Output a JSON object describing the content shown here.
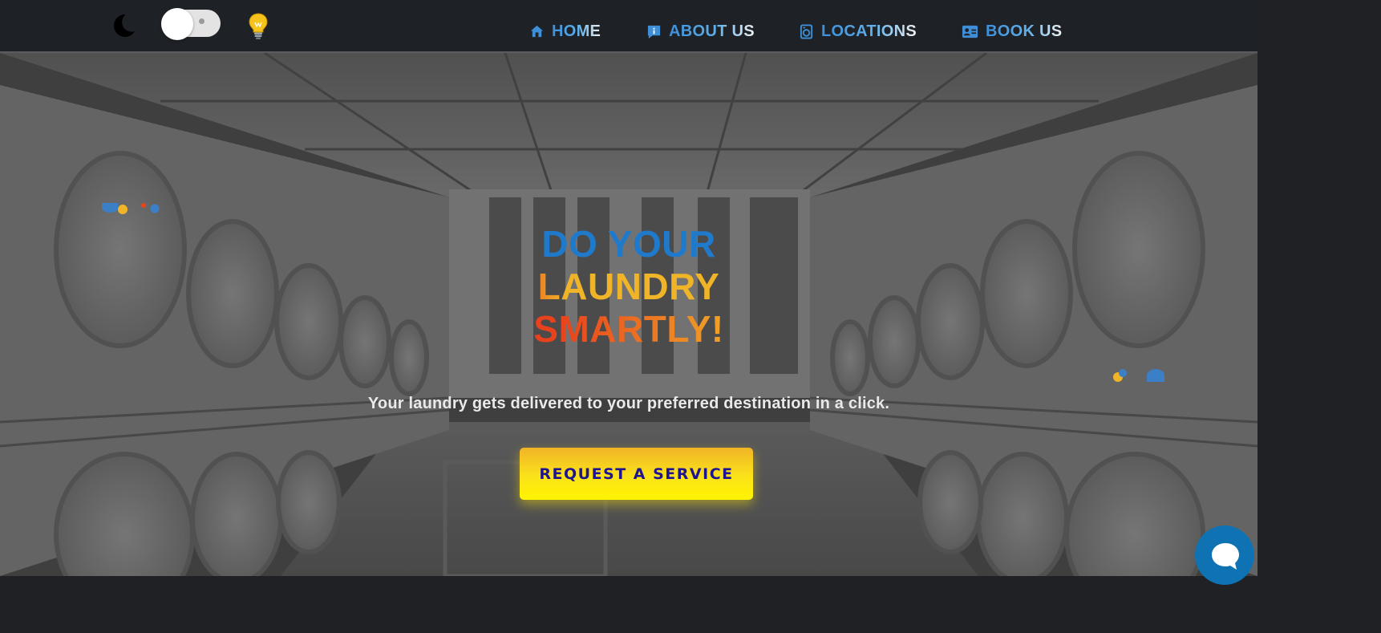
{
  "theme": {
    "dark_mode_enabled": false,
    "accent": "#1f7acc",
    "cta_text_color": "#1f148f",
    "cta_color": "#fbe21a"
  },
  "navbar": {
    "theme_icons": {
      "dark": "moon-icon",
      "light": "lightbulb-icon"
    },
    "links": [
      {
        "label": "HOME",
        "icon": "home-icon"
      },
      {
        "label": "ABOUT US",
        "icon": "info-icon"
      },
      {
        "label": "LOCATIONS",
        "icon": "washing-machine-icon"
      },
      {
        "label": "BOOK US",
        "icon": "contact-card-icon"
      }
    ]
  },
  "hero": {
    "headline": {
      "line1": "DO YOUR",
      "line2": "LAUNDRY",
      "line3": "SMARTLY!"
    },
    "subtitle": "Your laundry gets delivered to your preferred destination in a click.",
    "cta_label": "REQUEST A SERVICE",
    "background": "laundromat-photo"
  },
  "chat": {
    "icon": "chat-bubble-icon"
  }
}
